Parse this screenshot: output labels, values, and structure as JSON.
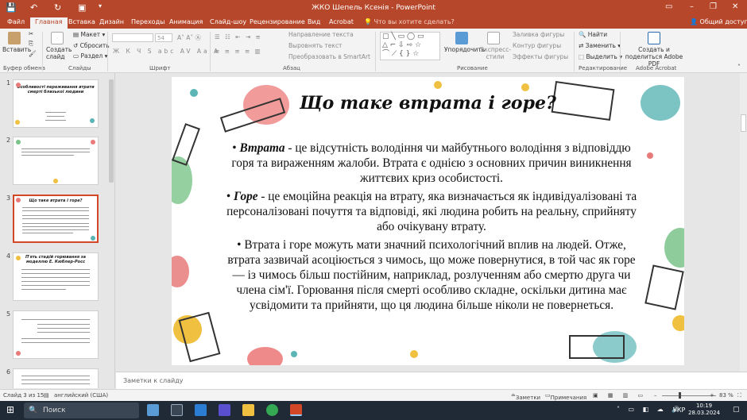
{
  "window": {
    "title": "ЖКО Шепель Ксенія - PowerPoint",
    "controls": [
      "minimize",
      "restore",
      "close"
    ]
  },
  "ribbon_tabs": {
    "file": "Файл",
    "home": "Главная",
    "insert": "Вставка",
    "design": "Дизайн",
    "transitions": "Переходы",
    "animations": "Анимация",
    "slideshow": "Слайд-шоу",
    "review": "Рецензирование",
    "view": "Вид",
    "acrobat": "Acrobat",
    "tellme": "Что вы хотите сделать?",
    "share": "Общий доступ"
  },
  "ribbon": {
    "paste": "Вставить",
    "create_slide": "Создать слайд",
    "layout": "Макет",
    "reset": "Сбросить",
    "section": "Раздел",
    "font_size": "54",
    "text_direction": "Направление текста",
    "align_text": "Выровнять текст",
    "smartart": "Преобразовать в SmartArt",
    "arrange": "Упорядочить",
    "quick_styles": "Экспресс-стили",
    "shape_fill": "Заливка фигуры",
    "shape_outline": "Контур фигуры",
    "shape_effects": "Эффекты фигуры",
    "find": "Найти",
    "replace": "Заменить",
    "select": "Выделить",
    "create_pdf": "Создать и поделиться Adobe PDF",
    "groups": {
      "clipboard": "Буфер обмена",
      "slides": "Слайды",
      "font": "Шрифт",
      "paragraph": "Абзац",
      "drawing": "Рисование",
      "editing": "Редактирование",
      "acrobat": "Adobe Acrobat"
    }
  },
  "thumbnails": [
    {
      "num": "1",
      "title": "Особливості переживання втрати смерті близької людини"
    },
    {
      "num": "2",
      "title": ""
    },
    {
      "num": "3",
      "title": "Що таке втрата і горе?"
    },
    {
      "num": "4",
      "title": "П'ять стадій горювання за моделлю Е. Кюблер-Росс"
    },
    {
      "num": "5",
      "title": ""
    },
    {
      "num": "6",
      "title": ""
    }
  ],
  "slide": {
    "title": "Що таке втрата і горе?",
    "p1_bullet": "•",
    "p1_term": "Втрата",
    "p1_text": " - це відсутність володіння чи майбутнього володіння з відповіддю горя та вираженням жалоби. Втрата є однією з основних причин виникнення життєвих криз особистості.",
    "p2_bullet": "•",
    "p2_term": "Горе",
    "p2_text": " - це емоційна реакція на втрату, яка визначається як індивідуалізовані та персоналізовані почуття та відповіді, які людина робить на реальну, сприйняту або очікувану втрату.",
    "p3_text": "• Втрата і горе можуть мати значний психологічний вплив на людей. Отже, втрата зазвичай асоціюється з чимось, що може повернутися, в той час як горе — із чимось більш постійним, наприклад, розлученням або смертю друга чи члена сім'ї. Горювання після смерті особливо складне, оскільки дитина має усвідомити та прийняти, що ця людина більше ніколи не повернеться."
  },
  "notes_placeholder": "Заметки к слайду",
  "status": {
    "slide_of": "Слайд 3 из 15",
    "language": "английский (США)",
    "notes": "Заметки",
    "comments": "Примечания",
    "zoom": "83 %"
  },
  "taskbar": {
    "search": "Поиск",
    "lang": "УКР",
    "time": "10:19",
    "date": "28.03.2024"
  },
  "colors": {
    "accent": "#b7472a",
    "taskbar": "#1f2a36"
  }
}
